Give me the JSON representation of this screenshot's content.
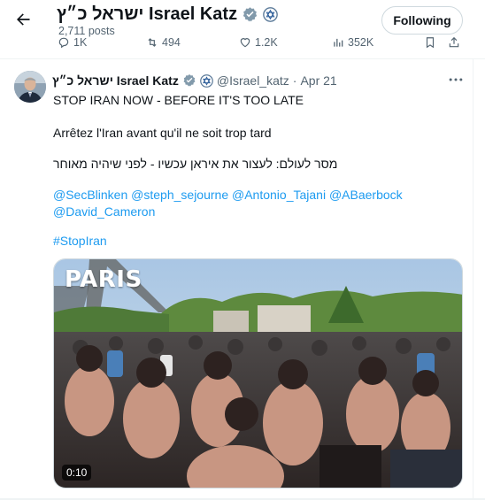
{
  "header": {
    "display_name": "ישראל כ״ץ Israel Katz",
    "post_count": "2,711 posts",
    "follow_label": "Following"
  },
  "prev_actions": {
    "replies": "1K",
    "reposts": "494",
    "likes": "1.2K",
    "views": "352K"
  },
  "tweet": {
    "name": "ישראל כ״ץ Israel Katz",
    "handle": "@Israel_katz",
    "separator": "·",
    "date": "Apr 21",
    "line1": "STOP IRAN NOW - BEFORE IT'S TOO LATE",
    "line2": "Arrêtez l'Iran avant qu'il ne soit trop tard",
    "line3": "מסר לעולם: לעצור את איראן עכשיו - לפני שיהיה מאוחר",
    "mentions": [
      "@SecBlinken",
      "@steph_sejourne",
      "@Antonio_Tajani",
      "@ABaerbock",
      "@David_Cameron"
    ],
    "hashtag": "#StopIran"
  },
  "media": {
    "brand_text": "PARIS",
    "duration": "0:10"
  },
  "icons": {
    "back": "arrow-left-icon",
    "verified": "verified-badge-icon",
    "government": "israel-flag-emblem-icon",
    "more": "more-horizontal-icon",
    "reply": "reply-icon",
    "repost": "repost-icon",
    "like": "heart-icon",
    "views": "views-chart-icon",
    "bookmark": "bookmark-icon",
    "share": "share-icon"
  },
  "colors": {
    "verified": "#829aab",
    "link": "#1d9bf0",
    "muted": "#536471"
  }
}
